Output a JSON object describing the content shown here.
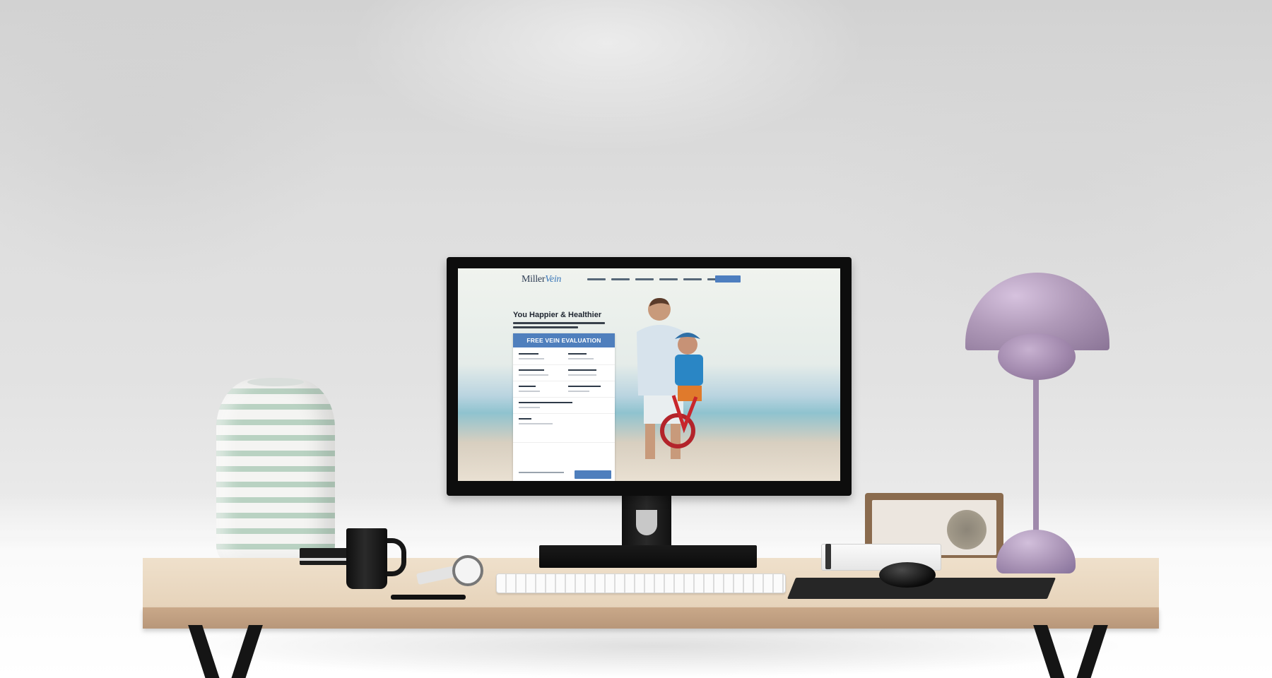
{
  "website": {
    "logo_primary": "Miller",
    "logo_accent": "Vein",
    "hero_title": "You Happier & Healthier",
    "form_title": "FREE VEIN EVALUATION"
  },
  "colors": {
    "brand_blue": "#4f7fbd",
    "vase_stripe": "#b9d2c2",
    "lamp_purple": "#b09ab9",
    "desk_wood": "#e6d3ba"
  }
}
